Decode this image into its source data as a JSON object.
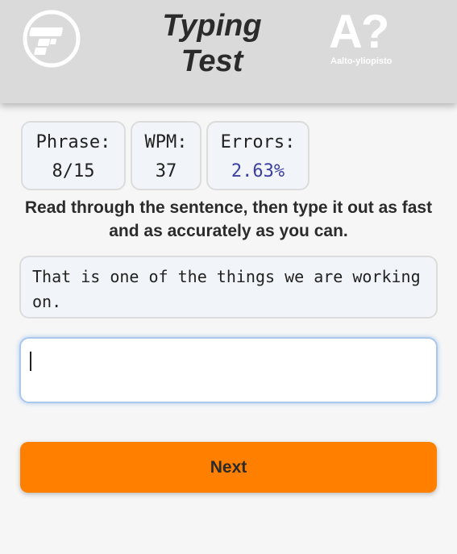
{
  "header": {
    "title_line1": "Typing",
    "title_line2": "Test",
    "aalto_mark": "A?",
    "aalto_text": "Aalto-yliopisto",
    "left_logo_icon": "typing-t-logo-icon"
  },
  "stats": {
    "phrase_label": "Phrase:",
    "phrase_value": "8/15",
    "wpm_label": "WPM:",
    "wpm_value": "37",
    "errors_label": "Errors:",
    "errors_value": "2.63%"
  },
  "instructions": "Read through the sentence, then type it out as fast and as accurately as you can.",
  "phrase": "That is one of the things we are working on.",
  "input": {
    "value": "",
    "placeholder": ""
  },
  "next_button": "Next",
  "colors": {
    "header_bg": "#dadada",
    "accent_orange": "#ff7f00",
    "errors_value": "#3b3f9e",
    "input_focus_border": "#a9c8ec"
  }
}
